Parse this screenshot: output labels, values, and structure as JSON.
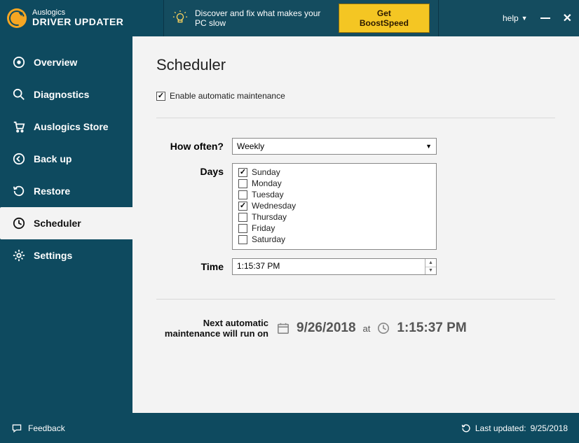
{
  "brand": {
    "line1": "Auslogics",
    "line2": "DRIVER UPDATER"
  },
  "promo": {
    "text": "Discover and fix what makes your PC slow",
    "button": "Get BoostSpeed"
  },
  "header": {
    "help": "help"
  },
  "sidebar": {
    "items": [
      {
        "label": "Overview"
      },
      {
        "label": "Diagnostics"
      },
      {
        "label": "Auslogics Store"
      },
      {
        "label": "Back up"
      },
      {
        "label": "Restore"
      },
      {
        "label": "Scheduler"
      },
      {
        "label": "Settings"
      }
    ]
  },
  "page": {
    "title": "Scheduler",
    "enable_label": "Enable automatic maintenance",
    "how_often_label": "How often?",
    "how_often_value": "Weekly",
    "days_label": "Days",
    "days": [
      {
        "label": "Sunday",
        "checked": true
      },
      {
        "label": "Monday",
        "checked": false
      },
      {
        "label": "Tuesday",
        "checked": false
      },
      {
        "label": "Wednesday",
        "checked": true
      },
      {
        "label": "Thursday",
        "checked": false
      },
      {
        "label": "Friday",
        "checked": false
      },
      {
        "label": "Saturday",
        "checked": false
      }
    ],
    "time_label": "Time",
    "time_value": "1:15:37 PM",
    "next_run_label": "Next automatic maintenance will run on",
    "next_run_date": "9/26/2018",
    "at": "at",
    "next_run_time": "1:15:37 PM"
  },
  "footer": {
    "feedback": "Feedback",
    "last_updated_label": "Last updated:",
    "last_updated_value": "9/25/2018"
  }
}
